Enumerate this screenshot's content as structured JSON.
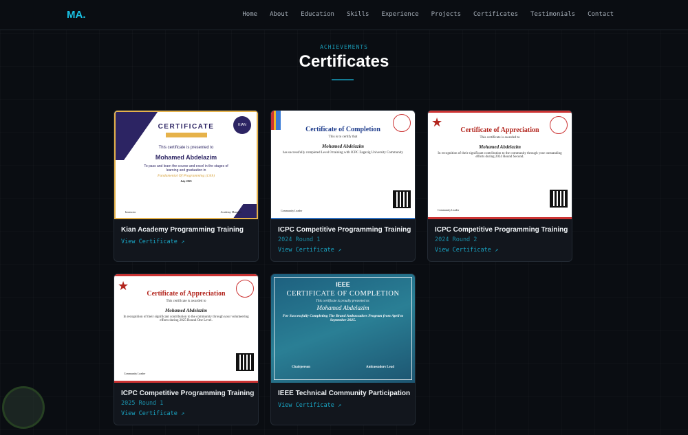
{
  "nav": {
    "logo": "MA.",
    "items": [
      "Home",
      "About",
      "Education",
      "Skills",
      "Experience",
      "Projects",
      "Certificates",
      "Testimonials",
      "Contact"
    ]
  },
  "section": {
    "eyebrow": "ACHIEVEMENTS",
    "title": "Certificates"
  },
  "link_label": "View Certificate",
  "cards": [
    {
      "title": "Kian Academy Programming Training",
      "subtitle": "",
      "cert": {
        "heading": "CERTIFICATE",
        "line": "This certificate is presented to",
        "name": "Mohamed Abdelazim",
        "body": "To pass and learn the course and excel in the stages of learning and graduation in",
        "course": "Fundamental Of Programming (13th)",
        "date": "July 2025",
        "sig1": "Instructor",
        "sig2": "Academy Manager",
        "badge": "KIAN"
      }
    },
    {
      "title": "ICPC Competitive Programming Training",
      "subtitle": "2024 Round 1",
      "cert": {
        "heading": "Certificate of Completion",
        "line": "This is to certify that",
        "name": "Mohamed Abdelazim",
        "body": "has successfully completed Level 0 training with ICPC Zagazig University Community",
        "sig1": "Community Leader"
      }
    },
    {
      "title": "ICPC Competitive Programming Training",
      "subtitle": "2024 Round 2",
      "cert": {
        "heading": "Certificate of Appreciation",
        "line": "This certificate is awarded to",
        "name": "Mohamed Abdelazim",
        "body": "In recognition of their significant contribution to the community through your outstanding efforts during 2024 Round Second.",
        "sig1": "Community Leader"
      }
    },
    {
      "title": "ICPC Competitive Programming Training",
      "subtitle": "2025 Round 1",
      "cert": {
        "heading": "Certificate of Appreciation",
        "line": "This certificate is awarded to",
        "name": "Mohamed Abdelazim",
        "body": "In recognition of their significant contribution to the community through your volunteering efforts during 2025 Round One Level.",
        "sig1": "Community Leader"
      }
    },
    {
      "title": "IEEE Technical Community Participation",
      "subtitle": "",
      "cert": {
        "logo": "IEEE",
        "heading": "CERTIFICATE OF COMPLETION",
        "line": "This certificate is proudly presented to:",
        "name": "Mohamed Abdelazim",
        "body": "For Successfully Completing The Brand Ambassadors Program from April to September 2025.",
        "sig1": "Chairperson",
        "sig2": "Ambassadors Lead"
      }
    }
  ],
  "colors": {
    "accent": "#19c3e6",
    "bg": "#0a0d12",
    "card": "#12161d"
  }
}
